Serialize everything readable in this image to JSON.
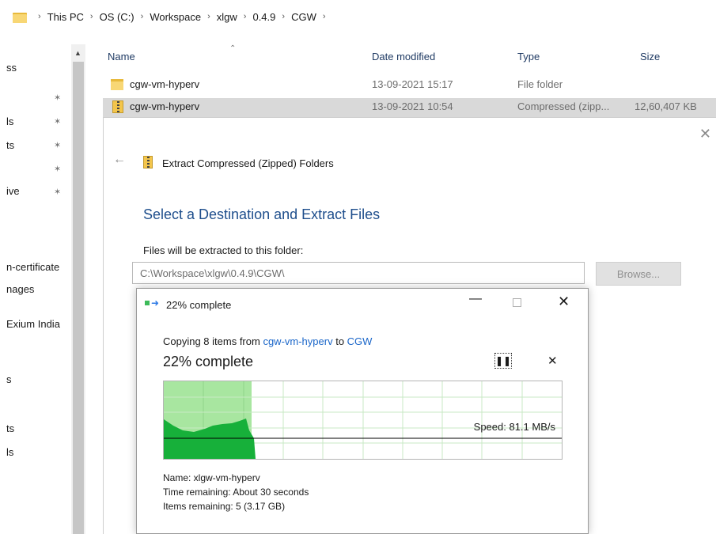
{
  "breadcrumb": {
    "items": [
      "This PC",
      "OS (C:)",
      "Workspace",
      "xlgw",
      "0.4.9",
      "CGW"
    ]
  },
  "nav": {
    "items": [
      {
        "label": "ss",
        "pinned": false
      },
      {
        "label": "",
        "pinned": true
      },
      {
        "label": "ls",
        "pinned": true
      },
      {
        "label": "ts",
        "pinned": true
      },
      {
        "label": "",
        "pinned": true
      },
      {
        "label": "ive",
        "pinned": true
      },
      {
        "label": "n-certificate",
        "pinned": false
      },
      {
        "label": "nages",
        "pinned": false
      },
      {
        "label": "Exium India",
        "pinned": false
      },
      {
        "label": "s",
        "pinned": false
      },
      {
        "label": "ts",
        "pinned": false
      },
      {
        "label": "ls",
        "pinned": false
      }
    ]
  },
  "file_list": {
    "columns": [
      "Name",
      "Date modified",
      "Type",
      "Size"
    ],
    "rows": [
      {
        "name": "cgw-vm-hyperv",
        "date": "13-09-2021 15:17",
        "type": "File folder",
        "size": "",
        "icon": "folder-icon"
      },
      {
        "name": "cgw-vm-hyperv",
        "date": "13-09-2021 10:54",
        "type": "Compressed (zipp...",
        "size": "12,60,407 KB",
        "icon": "zip-folder-icon"
      }
    ]
  },
  "wizard": {
    "title": "Extract Compressed (Zipped) Folders",
    "heading": "Select a Destination and Extract Files",
    "label": "Files will be extracted to this folder:",
    "path": "C:\\Workspace\\xlgw\\0.4.9\\CGW\\",
    "browse_label": "Browse..."
  },
  "progress": {
    "title": "22% complete",
    "copying_prefix": "Copying 8 items from",
    "source": "cgw-vm-hyperv",
    "to_word": "to",
    "destination": "CGW",
    "percent_text": "22% complete",
    "percent": 0.22,
    "speed_text": "Speed: 81.1 MB/s",
    "name_line": "Name: xlgw-vm-hyperv",
    "time_line": "Time remaining:  About 30 seconds",
    "items_line": "Items remaining:  5 (3.17 GB)",
    "pause_glyph": "❚❚",
    "cancel_glyph": "✕",
    "minimize_glyph": "—",
    "close_glyph": "✕"
  },
  "colors": {
    "graph_fill_light": "#a8e6a0",
    "graph_fill_dark": "#17b03a",
    "link": "#1a66c9",
    "heading": "#1e4e8c",
    "selected_row": "#d9d9d9"
  }
}
